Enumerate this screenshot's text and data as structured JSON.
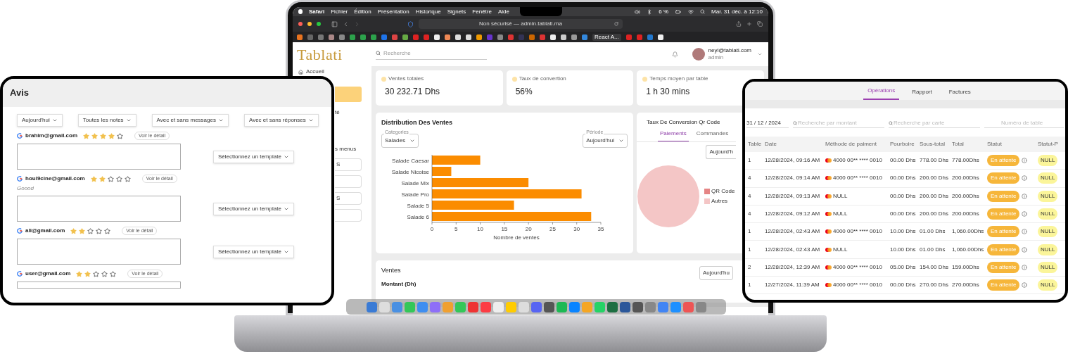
{
  "laptop": {
    "menu_bar": {
      "app": "Safari",
      "items": [
        "Fichier",
        "Édition",
        "Présentation",
        "Historique",
        "Signets",
        "Fenêtre",
        "Aide"
      ],
      "battery": "6 %",
      "clock": "Mar. 31 déc. à 12:10"
    },
    "browser": {
      "address": "Non sécurisé — admin.tablati.ma",
      "bookmark_tab": "React A..."
    },
    "header": {
      "logo": "Tablati",
      "search_placeholder": "Recherche",
      "user_email": "neyl@tablati.com",
      "user_role": "admin"
    },
    "sidebar": {
      "items": [
        {
          "label": "Accueil",
          "selected": false
        },
        {
          "selected": true
        },
        {
          "label": "té",
          "selected": false
        },
        {
          "label": "s menus",
          "selected": false
        }
      ],
      "sub_items": [
        {
          "kind": "labeled",
          "label": "S"
        },
        {
          "kind": "blank"
        },
        {
          "kind": "labeled",
          "label": "S"
        },
        {
          "kind": "blank"
        }
      ]
    },
    "stats": [
      {
        "label": "Ventes totales",
        "value": "30 232.71 Dhs"
      },
      {
        "label": "Taux de convertion",
        "value": "56%"
      },
      {
        "label": "Temps moyen par table",
        "value": "1 h 30 mins"
      }
    ],
    "sales_distribution": {
      "title": "Distribution Des Ventes",
      "category_select": {
        "label": "Categories",
        "value": "Salades"
      },
      "period_select": {
        "label": "Période",
        "value": "Aujourd'hui"
      },
      "chart_data": {
        "type": "bar",
        "orientation": "horizontal",
        "xlabel": "Nombre de ventes",
        "categories": [
          "Salade Caesar",
          "Salade Nicoise",
          "Salade Mix",
          "Salade Pro",
          "Salade 5",
          "Salade 6"
        ],
        "series": [
          {
            "color": "#fb8c00",
            "values": [
              10,
              4,
              20,
              31,
              17,
              33
            ]
          }
        ],
        "xlim": [
          0,
          35
        ],
        "xticks": [
          0,
          5,
          10,
          15,
          20,
          25,
          30,
          35
        ]
      }
    },
    "qr_conversion": {
      "title": "Taux De Conversion Qr Code",
      "tabs": [
        {
          "label": "Paiements",
          "selected": true
        },
        {
          "label": "Commandes",
          "selected": false
        }
      ],
      "period": "Aujourd'h",
      "chart_data": {
        "type": "pie",
        "categories": [
          "QR Code",
          "Autres"
        ],
        "values": [
          0,
          100
        ],
        "colors": [
          "#e58585",
          "#f4c6c6"
        ]
      }
    },
    "sales": {
      "title": "Ventes",
      "subtitle": "Montant (Dh)",
      "period": "Aujourd'hu"
    }
  },
  "reviews_tablet": {
    "title": "Avis",
    "filters": [
      "Aujourd'hui",
      "Toutes les notes",
      "Avec et sans messages",
      "Avec et sans réponses"
    ],
    "reviews": [
      {
        "email": "brahim@gmail.com",
        "stars": 4,
        "detail": "Voir le détail",
        "template": "Sélectionnez un template"
      },
      {
        "email": "houl9cine@gmail.com",
        "stars": 2,
        "detail": "Voir le détail",
        "message": "Goood",
        "template": "Sélectionnez un template"
      },
      {
        "email": "ali@gmail.com",
        "stars": 2,
        "detail": "Voir le détail",
        "template": "Sélectionnez un template"
      },
      {
        "email": "user@gmail.com",
        "stars": 2,
        "detail": "Voir le détail"
      }
    ]
  },
  "operations_tablet": {
    "tabs": [
      {
        "label": "Opérations",
        "selected": true
      },
      {
        "label": "Rapport",
        "selected": false
      },
      {
        "label": "Factures",
        "selected": false
      }
    ],
    "date": "31 / 12 / 2024",
    "amount_placeholder": "Recherche par montant",
    "card_placeholder": "Recherche par carte",
    "table_placeholder": "Numéro de table",
    "columns": [
      "Table",
      "Date",
      "Méthode de paiment",
      "Pourboire",
      "Sous-total",
      "Total",
      "Statut",
      "Statut-P"
    ],
    "rows": [
      {
        "table": "1",
        "date": "12/28/2024, 09:16 AM",
        "method": "4000 00** **** 0010",
        "tip": "00.00 Dhs",
        "subtotal": "778.00 Dhs",
        "total": "778.00Dhs",
        "status": "En attente",
        "payment_status": "NULL"
      },
      {
        "table": "4",
        "date": "12/28/2024, 09:14 AM",
        "method": "4000 00** **** 0010",
        "tip": "00.00 Dhs",
        "subtotal": "200.00 Dhs",
        "total": "200.00Dhs",
        "status": "En attente",
        "payment_status": "NULL"
      },
      {
        "table": "4",
        "date": "12/28/2024, 09:13 AM",
        "method": "NULL",
        "tip": "00.00 Dhs",
        "subtotal": "200.00 Dhs",
        "total": "200.00Dhs",
        "status": "En attente",
        "payment_status": "NULL"
      },
      {
        "table": "4",
        "date": "12/28/2024, 09:12 AM",
        "method": "NULL",
        "tip": "00.00 Dhs",
        "subtotal": "200.00 Dhs",
        "total": "200.00Dhs",
        "status": "En attente",
        "payment_status": "NULL"
      },
      {
        "table": "1",
        "date": "12/28/2024, 02:43 AM",
        "method": "4000 00** **** 0010",
        "tip": "10.00 Dhs",
        "subtotal": "01.00 Dhs",
        "total": "1,060.00Dhs",
        "status": "En attente",
        "payment_status": "NULL"
      },
      {
        "table": "1",
        "date": "12/28/2024, 02:43 AM",
        "method": "NULL",
        "tip": "10.00 Dhs",
        "subtotal": "01.00 Dhs",
        "total": "1,060.00Dhs",
        "status": "En attente",
        "payment_status": "NULL"
      },
      {
        "table": "2",
        "date": "12/28/2024, 12:39 AM",
        "method": "4000 00** **** 0010",
        "tip": "05.00 Dhs",
        "subtotal": "154.00 Dhs",
        "total": "159.00Dhs",
        "status": "En attente",
        "payment_status": "NULL"
      },
      {
        "table": "1",
        "date": "12/27/2024, 11:39 AM",
        "method": "4000 00** **** 0010",
        "tip": "00.00 Dhs",
        "subtotal": "270.00 Dhs",
        "total": "270.00Dhs",
        "status": "En attente",
        "payment_status": "NULL"
      }
    ]
  }
}
